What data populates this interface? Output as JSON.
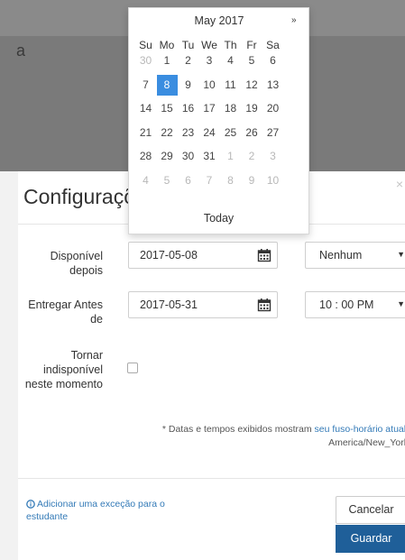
{
  "background": {
    "partial_char": "a"
  },
  "modal": {
    "title": "Configurações",
    "close_glyph": "×",
    "available_after": {
      "label": "Disponível depois",
      "date": "2017-05-08",
      "time": "Nenhum"
    },
    "due_before": {
      "label": "Entregar Antes de",
      "date": "2017-05-31",
      "time": "10 : 00 PM"
    },
    "make_unavailable": {
      "label": "Tornar indisponível neste momento"
    },
    "tz_note": {
      "prefix": "* Datas e tempos exibidos mostram ",
      "link": "seu fuso-horário atual:",
      "zone": "America/New_York"
    },
    "exception_link": "Adicionar uma exceção para o estudante",
    "cancel_label": "Cancelar",
    "save_label": "Guardar"
  },
  "datepicker": {
    "month_label": "May 2017",
    "next_label": "»",
    "today_label": "Today",
    "weekdays": [
      "Su",
      "Mo",
      "Tu",
      "We",
      "Th",
      "Fr",
      "Sa"
    ],
    "weeks": [
      [
        "30",
        "1",
        "2",
        "3",
        "4",
        "5",
        "6"
      ],
      [
        "7",
        "8",
        "9",
        "10",
        "11",
        "12",
        "13"
      ],
      [
        "14",
        "15",
        "16",
        "17",
        "18",
        "19",
        "20"
      ],
      [
        "21",
        "22",
        "23",
        "24",
        "25",
        "26",
        "27"
      ],
      [
        "28",
        "29",
        "30",
        "31",
        "1",
        "2",
        "3"
      ],
      [
        "4",
        "5",
        "6",
        "7",
        "8",
        "9",
        "10"
      ]
    ],
    "muted": [
      [
        true,
        false,
        false,
        false,
        false,
        false,
        false
      ],
      [
        false,
        false,
        false,
        false,
        false,
        false,
        false
      ],
      [
        false,
        false,
        false,
        false,
        false,
        false,
        false
      ],
      [
        false,
        false,
        false,
        false,
        false,
        false,
        false
      ],
      [
        false,
        false,
        false,
        false,
        true,
        true,
        true
      ],
      [
        true,
        true,
        true,
        true,
        true,
        true,
        true
      ]
    ],
    "selected": "8",
    "selected_color": "#3a8de0"
  },
  "colors": {
    "primary": "#1f5f99",
    "link": "#337ab7"
  },
  "icons": {
    "calendar": "calendar-icon",
    "info": "info-circle-icon",
    "caret": "caret-down-icon"
  }
}
